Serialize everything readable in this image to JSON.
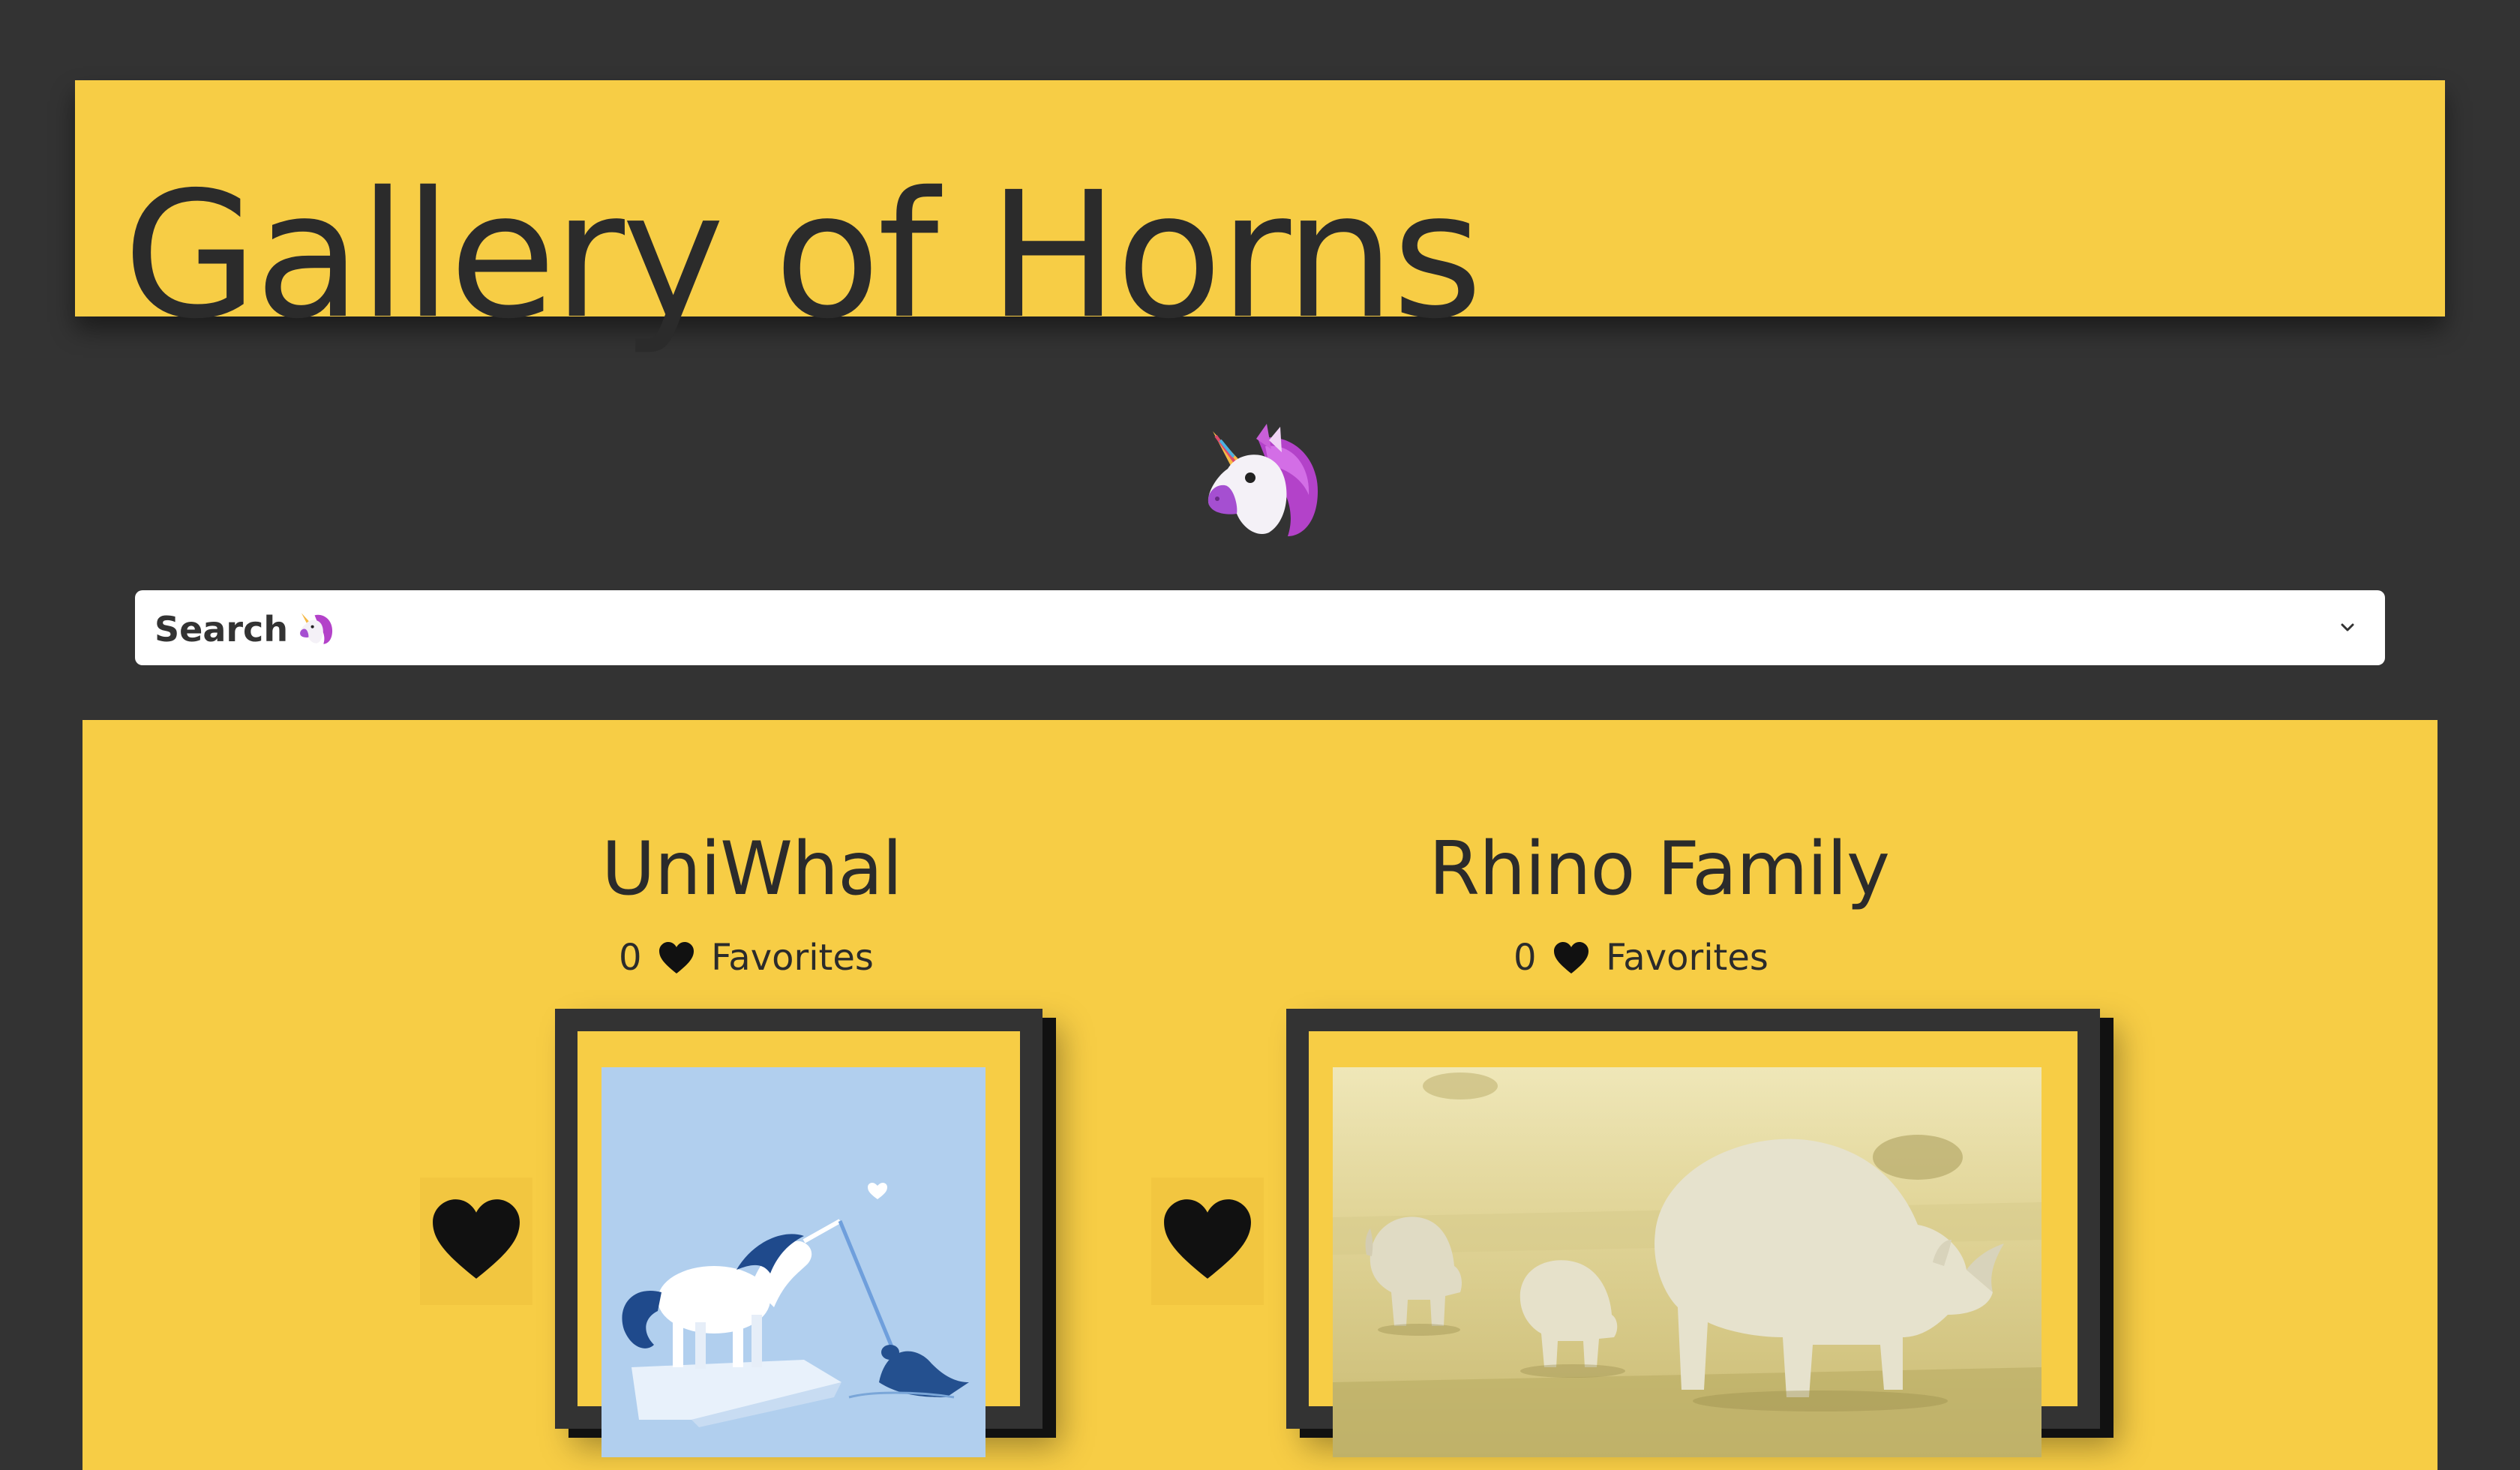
{
  "header": {
    "title": "Gallery of Horns"
  },
  "logo": {
    "icon": "unicorn-icon"
  },
  "search": {
    "label": "Search",
    "icon": "unicorn-icon",
    "chevron_icon": "chevron-down-icon"
  },
  "cards": [
    {
      "title": "UniWhal",
      "favorites_count": "0",
      "favorites_label": "Favorites",
      "heart_icon": "black-heart-icon",
      "image_subject": "unicorn and narwhal"
    },
    {
      "title": "Rhino Family",
      "favorites_count": "0",
      "favorites_label": "Favorites",
      "heart_icon": "black-heart-icon",
      "image_subject": "rhino family grazing"
    }
  ],
  "colors": {
    "background": "#333333",
    "accent": "#f7cd45",
    "text": "#2b2b2b"
  }
}
